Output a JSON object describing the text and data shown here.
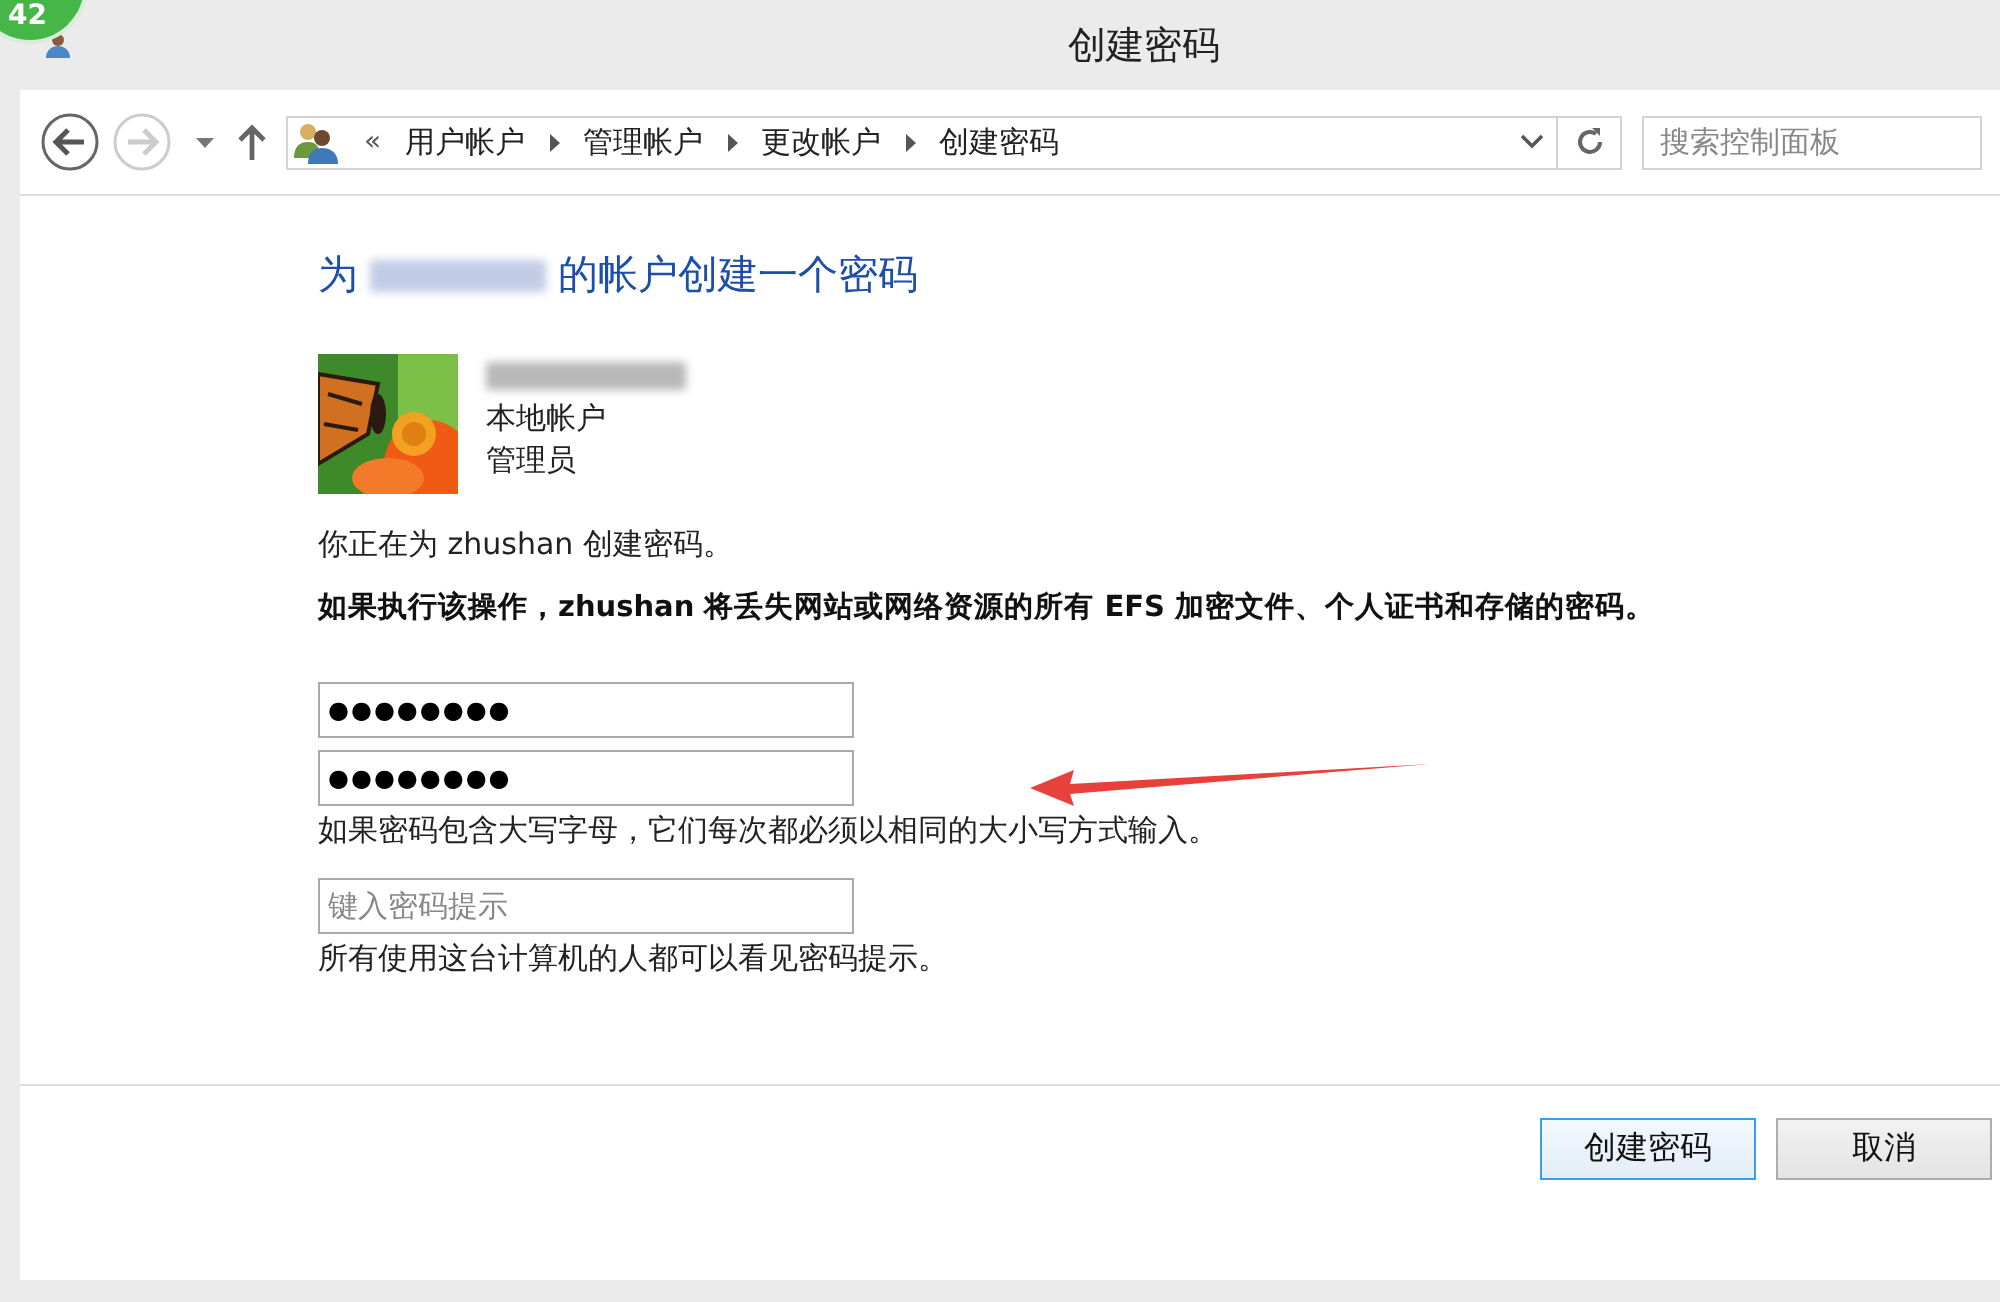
{
  "badge": "42",
  "window": {
    "title": "创建密码"
  },
  "nav": {
    "breadcrumb_lead": "«",
    "breadcrumb": [
      "用户帐户",
      "管理帐户",
      "更改帐户",
      "创建密码"
    ],
    "search": {
      "placeholder": "搜索控制面板"
    }
  },
  "heading": {
    "prefix": "为",
    "suffix": "的帐户创建一个密码"
  },
  "account": {
    "details": [
      "本地帐户",
      "管理员"
    ]
  },
  "info": "你正在为 zhushan 创建密码。",
  "warning": "如果执行该操作，zhushan 将丢失网站或网络资源的所有 EFS 加密文件、个人证书和存储的密码。",
  "password_fields": [
    {
      "value": "●●●●●●●●"
    },
    {
      "value": "●●●●●●●●"
    }
  ],
  "case_note": "如果密码包含大写字母，它们每次都必须以相同的大小写方式输入。",
  "hint_field": {
    "placeholder": "键入密码提示"
  },
  "hint_note": "所有使用这台计算机的人都可以看见密码提示。",
  "buttons": [
    {
      "label": "创建密码",
      "selected": true
    },
    {
      "label": "取消",
      "selected": false
    }
  ]
}
